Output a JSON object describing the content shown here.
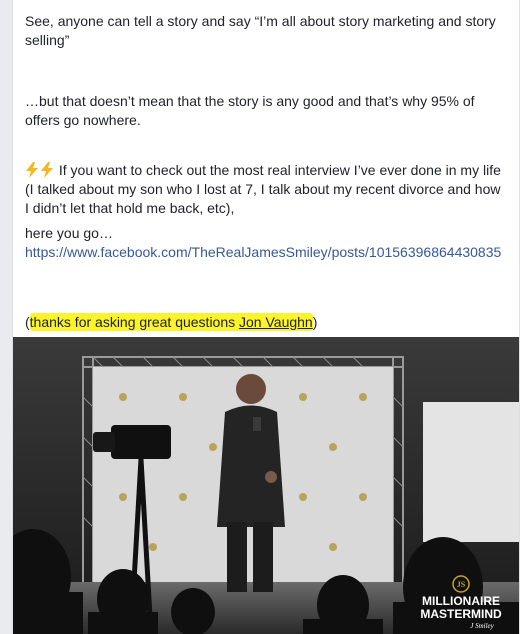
{
  "post": {
    "paragraph1": "See, anyone can tell a story and say “I’m all about story marketing and story selling”",
    "paragraph2": "…but that doesn’t mean that the story is any good and that’s why 95% of offers go nowhere.",
    "paragraph3": "If you want to check out the most real interview I’ve ever done in my life (I talked about my son who I lost at 7, I talk about my recent divorce and how I didn’t let that hold me back, etc),",
    "here_text": "here you go…",
    "link_url": "https://www.facebook.com/TheRealJamesSmiley/posts/10156396864430835",
    "thanks_open": "(",
    "thanks_text": "thanks for asking great questions ",
    "mention_name": "Jon Vaughn",
    "thanks_close": ")"
  },
  "photo": {
    "logo_initials": "JS",
    "logo_line1": "MILLIONAIRE",
    "logo_line2": "MASTERMIND",
    "logo_signature": "J Smiley"
  },
  "colors": {
    "link": "#365899",
    "highlight": "#fbf42b",
    "logo_gold": "#c9a227"
  },
  "icons": [
    "lightning-bolt-icon",
    "lightning-bolt-icon"
  ]
}
